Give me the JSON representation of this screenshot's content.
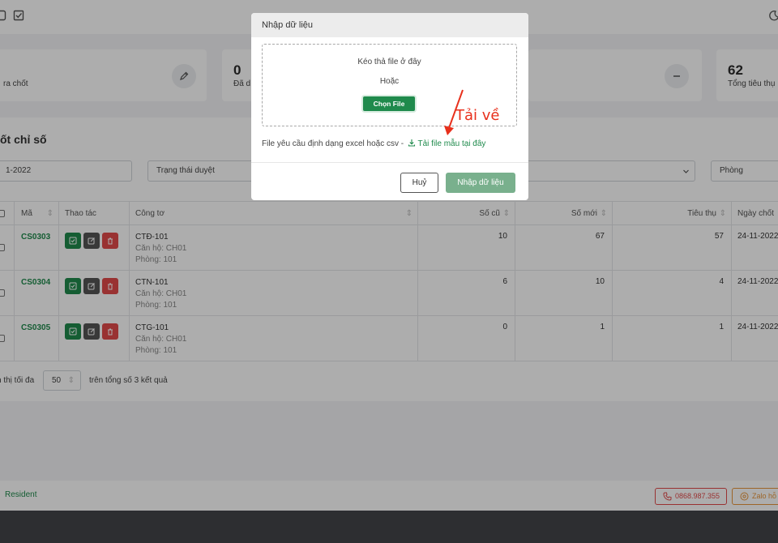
{
  "topbar": {
    "icons": [
      "square-icon",
      "checkbox-icon",
      "moon-icon"
    ]
  },
  "stats": [
    {
      "number": "",
      "label": "ra chốt",
      "icon": "pen-icon"
    },
    {
      "number": "0",
      "label": "Đã d",
      "icon": ""
    },
    {
      "number": "",
      "label": "",
      "icon": "minus-icon"
    },
    {
      "number": "62",
      "label": "Tổng tiêu thụ",
      "icon": ""
    }
  ],
  "section": {
    "title": "ốt chỉ số",
    "filters": {
      "date": "1-2022",
      "status": "Trạng thái duyệt",
      "dropdown": "",
      "room": "Phòng"
    }
  },
  "table": {
    "headers": {
      "ma": "Mã",
      "thao_tac": "Thao tác",
      "cong_to": "Công tơ",
      "so_cu": "Số cũ",
      "so_moi": "Số mới",
      "tieu_thu": "Tiêu thụ",
      "ngay_chot": "Ngày chốt"
    },
    "rows": [
      {
        "code": "CS0303",
        "meter": "CTĐ-101",
        "apartment": "Căn hộ: CH01",
        "room": "Phòng: 101",
        "old": "10",
        "new": "67",
        "usage": "57",
        "date": "24-11-2022"
      },
      {
        "code": "CS0304",
        "meter": "CTN-101",
        "apartment": "Căn hộ: CH01",
        "room": "Phòng: 101",
        "old": "6",
        "new": "10",
        "usage": "4",
        "date": "24-11-2022"
      },
      {
        "code": "CS0305",
        "meter": "CTG-101",
        "apartment": "Căn hộ: CH01",
        "room": "Phòng: 101",
        "old": "0",
        "new": "1",
        "usage": "1",
        "date": "24-11-2022"
      }
    ]
  },
  "pager": {
    "show_label": "n thị tối đa",
    "page_size": "50",
    "total_text": "trên tổng số 3 kết quả"
  },
  "footer": {
    "brand": "Resident",
    "phone": "0868.987.355",
    "zalo": "Zalo hỗ"
  },
  "modal": {
    "title": "Nhập dữ liệu",
    "drop_text": "Kéo thả file ở đây",
    "or_text": "Hoặc",
    "choose_file": "Chọn File",
    "requirement": "File yêu cầu định dạng excel hoặc csv -",
    "download_link": "Tải file mẫu tại đây",
    "cancel": "Huỷ",
    "submit": "Nhập dữ liệu"
  },
  "annotation": {
    "text": "Tải về",
    "color": "#e8301c"
  },
  "colors": {
    "brand_green": "#1f8a4c",
    "danger_red": "#e24b4b",
    "dark_gray": "#555555"
  }
}
